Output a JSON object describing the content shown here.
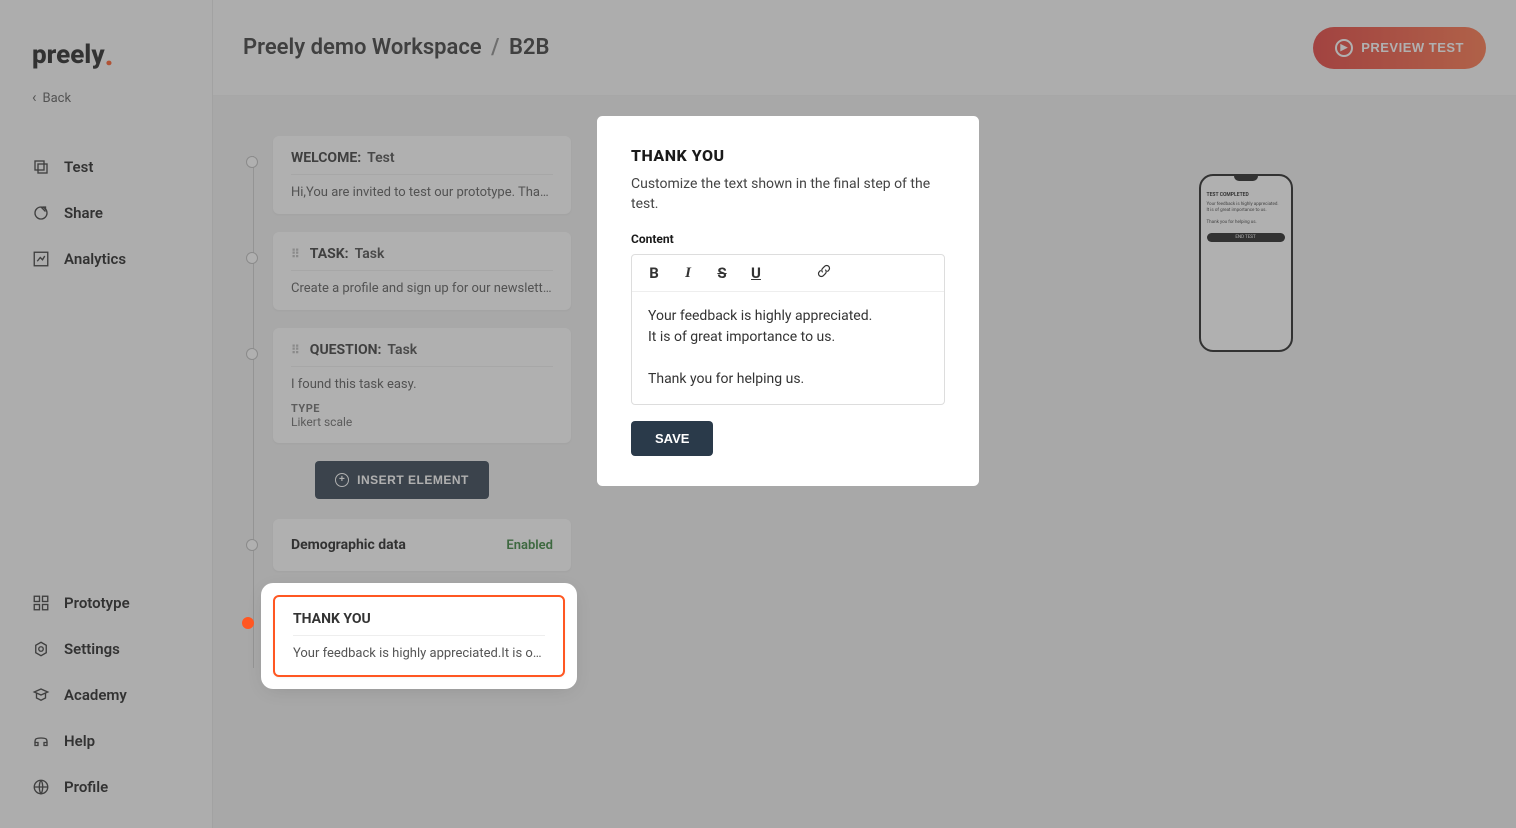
{
  "brand": "preely",
  "back_label": "Back",
  "nav": {
    "test": "Test",
    "share": "Share",
    "analytics": "Analytics",
    "prototype": "Prototype",
    "settings": "Settings",
    "academy": "Academy",
    "help": "Help",
    "profile": "Profile"
  },
  "breadcrumb": {
    "workspace": "Preely demo Workspace",
    "project": "B2B"
  },
  "preview_label": "PREVIEW TEST",
  "steps": {
    "welcome": {
      "label": "WELCOME:",
      "name": "Test",
      "body": "Hi,You are invited to test our prototype. Thank …"
    },
    "task": {
      "label": "TASK:",
      "name": "Task",
      "body": "Create a profile and sign up for our newsletter."
    },
    "question": {
      "label": "QUESTION:",
      "name": "Task",
      "body": "I found this task easy.",
      "type_label": "TYPE",
      "type_value": "Likert scale"
    },
    "insert_label": "INSERT ELEMENT",
    "demographic": {
      "title": "Demographic data",
      "status": "Enabled"
    },
    "thankyou": {
      "label": "THANK YOU",
      "body": "Your feedback is highly appreciated.It is of gre…"
    }
  },
  "editor": {
    "title": "THANK YOU",
    "desc": "Customize the text shown in the final step of the test.",
    "content_label": "Content",
    "body": "Your feedback is highly appreciated.\nIt is of great importance to us.\n\nThank you for helping us.",
    "save_label": "SAVE"
  },
  "phone": {
    "heading": "TEST COMPLETED",
    "body": "Your feedback is highly appreciated.\nIt is of great importance to us.\n\nThank you for helping us.",
    "button": "END TEST"
  }
}
